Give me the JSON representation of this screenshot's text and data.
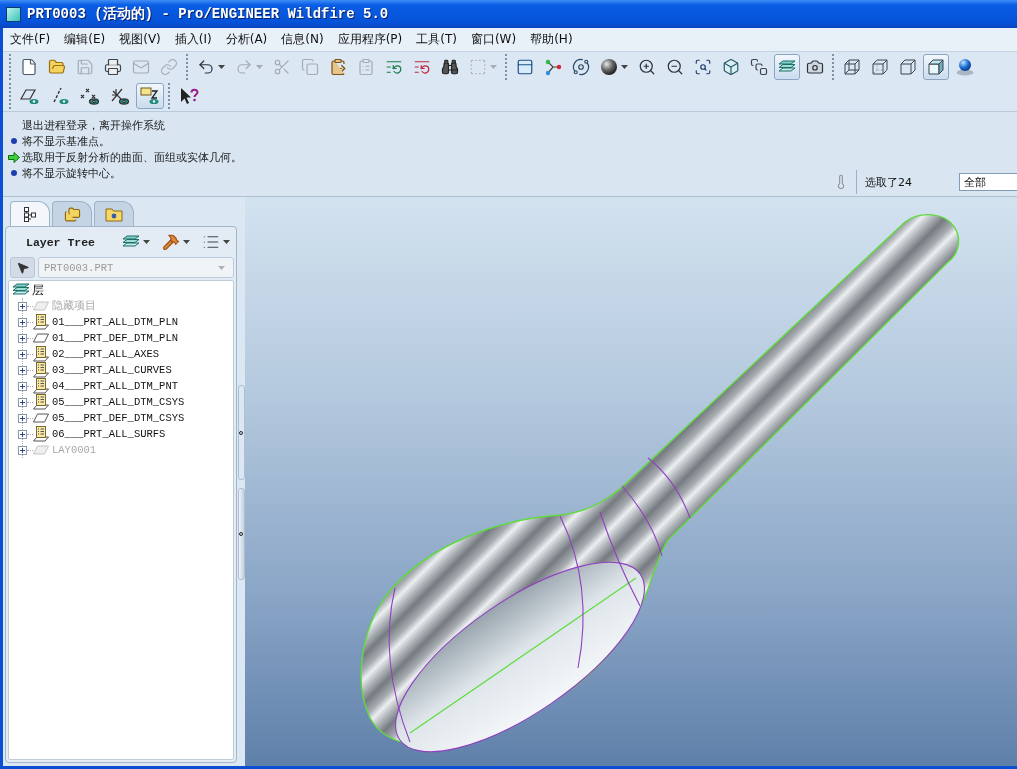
{
  "window": {
    "title": "PRT0003 (活动的) - Pro/ENGINEER Wildfire 5.0"
  },
  "menu": [
    "文件(F)",
    "编辑(E)",
    "视图(V)",
    "插入(I)",
    "分析(A)",
    "信息(N)",
    "应用程序(P)",
    "工具(T)",
    "窗口(W)",
    "帮助(H)"
  ],
  "toolbar": {
    "rows": [
      {
        "groups": [
          {
            "buttons": [
              {
                "disabled": false,
                "pressed": false
              },
              {
                "disabled": false,
                "pressed": false
              },
              {
                "disabled": true,
                "pressed": false
              },
              {
                "disabled": false,
                "pressed": false
              },
              {
                "disabled": true,
                "pressed": false
              },
              {
                "disabled": true,
                "pressed": false
              }
            ]
          },
          {
            "buttons": [
              {
                "disabled": false,
                "pressed": false,
                "menu": true
              },
              {
                "disabled": true,
                "pressed": false,
                "menu": true
              },
              {
                "disabled": true,
                "pressed": false
              },
              {
                "disabled": true,
                "pressed": false
              },
              {
                "disabled": false,
                "pressed": false
              },
              {
                "disabled": true,
                "pressed": false
              },
              {
                "disabled": false,
                "pressed": false
              },
              {
                "disabled": false,
                "pressed": false
              },
              {
                "disabled": false,
                "pressed": false
              },
              {
                "disabled": true,
                "pressed": false,
                "menu": true
              }
            ]
          },
          {
            "buttons": [
              {
                "disabled": false,
                "pressed": false
              },
              {
                "disabled": false,
                "pressed": false
              },
              {
                "disabled": false,
                "pressed": false
              },
              {
                "disabled": false,
                "pressed": false,
                "menu": true
              },
              {
                "disabled": false,
                "pressed": false
              },
              {
                "disabled": false,
                "pressed": false
              },
              {
                "disabled": false,
                "pressed": false
              },
              {
                "disabled": false,
                "pressed": false
              },
              {
                "disabled": false,
                "pressed": false
              },
              {
                "disabled": false,
                "pressed": true
              },
              {
                "disabled": false,
                "pressed": false
              }
            ]
          },
          {
            "buttons": [
              {
                "disabled": false,
                "pressed": false
              },
              {
                "disabled": false,
                "pressed": false
              },
              {
                "disabled": false,
                "pressed": false
              },
              {
                "disabled": false,
                "pressed": true
              },
              {
                "disabled": false,
                "pressed": false
              }
            ]
          }
        ]
      },
      {
        "groups": [
          {
            "buttons": [
              {
                "disabled": false,
                "pressed": false
              },
              {
                "disabled": false,
                "pressed": false
              },
              {
                "disabled": false,
                "pressed": false
              },
              {
                "disabled": false,
                "pressed": false
              },
              {
                "disabled": false,
                "pressed": true
              }
            ]
          },
          {
            "buttons": [
              {
                "disabled": false,
                "pressed": false
              }
            ]
          }
        ]
      }
    ]
  },
  "messages": [
    {
      "kind": "plain",
      "text": "退出进程登录，离开操作系统"
    },
    {
      "kind": "info",
      "text": "将不显示基准点。"
    },
    {
      "kind": "prompt",
      "text": "选取用于反射分析的曲面、面组或实体几何。"
    },
    {
      "kind": "info",
      "text": "将不显示旋转中心。"
    }
  ],
  "status": {
    "selection": "选取了24",
    "filter": "全部"
  },
  "navigator": {
    "tabs": [
      {
        "selected": true
      },
      {
        "selected": false
      },
      {
        "selected": false
      }
    ],
    "title": "Layer Tree",
    "model_selector": {
      "value": "PRT0003.PRT",
      "disabled": true
    },
    "tree": {
      "label": "层",
      "children": [
        {
          "label": "隐藏项目",
          "kind": "empty",
          "disabled": true,
          "expanded": false
        },
        {
          "label": "01___PRT_ALL_DTM_PLN",
          "kind": "populated",
          "disabled": false,
          "expanded": false
        },
        {
          "label": "01___PRT_DEF_DTM_PLN",
          "kind": "empty",
          "disabled": false,
          "expanded": false
        },
        {
          "label": "02___PRT_ALL_AXES",
          "kind": "populated",
          "disabled": false,
          "expanded": false
        },
        {
          "label": "03___PRT_ALL_CURVES",
          "kind": "populated",
          "disabled": false,
          "expanded": false
        },
        {
          "label": "04___PRT_ALL_DTM_PNT",
          "kind": "populated",
          "disabled": false,
          "expanded": false
        },
        {
          "label": "05___PRT_ALL_DTM_CSYS",
          "kind": "populated",
          "disabled": false,
          "expanded": false
        },
        {
          "label": "05___PRT_DEF_DTM_CSYS",
          "kind": "empty",
          "disabled": false,
          "expanded": false
        },
        {
          "label": "06___PRT_ALL_SURFS",
          "kind": "populated",
          "disabled": false,
          "expanded": false
        },
        {
          "label": "LAY0001",
          "kind": "empty",
          "disabled": true,
          "expanded": false
        }
      ]
    }
  }
}
